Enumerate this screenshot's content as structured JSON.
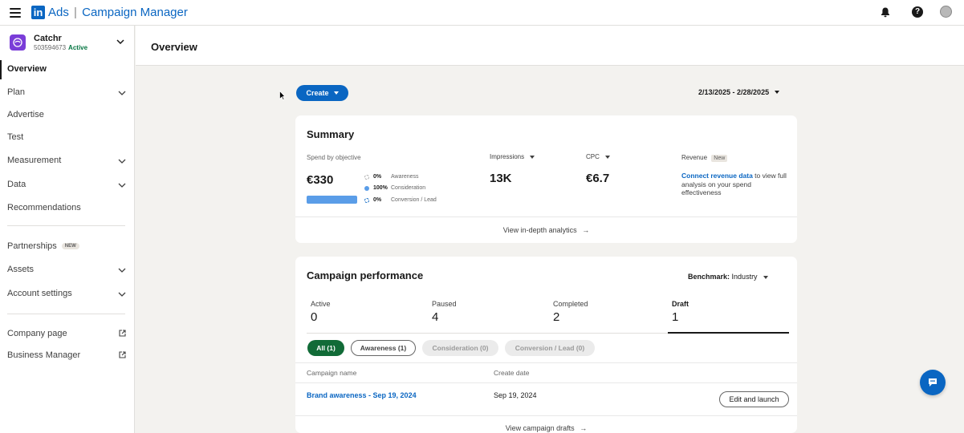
{
  "app": {
    "brand": "Ads",
    "separator": "|",
    "title": "Campaign Manager",
    "logo": "in"
  },
  "account": {
    "name": "Catchr",
    "id": "503594673",
    "status": "Active"
  },
  "sidebar": {
    "items": [
      {
        "label": "Overview"
      },
      {
        "label": "Plan"
      },
      {
        "label": "Advertise"
      },
      {
        "label": "Test"
      },
      {
        "label": "Measurement"
      },
      {
        "label": "Data"
      },
      {
        "label": "Recommendations"
      },
      {
        "label": "Partnerships",
        "badge": "NEW"
      },
      {
        "label": "Assets"
      },
      {
        "label": "Account settings"
      },
      {
        "label": "Company page"
      },
      {
        "label": "Business Manager"
      }
    ]
  },
  "page": {
    "title": "Overview"
  },
  "toolbar": {
    "create_label": "Create",
    "date_range": "2/13/2025 - 2/28/2025"
  },
  "summary": {
    "title": "Summary",
    "spend_label": "Spend by objective",
    "spend_value": "€330",
    "objectives": [
      {
        "pct": "0%",
        "name": "Awareness"
      },
      {
        "pct": "100%",
        "name": "Consideration"
      },
      {
        "pct": "0%",
        "name": "Conversion / Lead"
      }
    ],
    "impressions_label": "Impressions",
    "impressions_value": "13K",
    "cpc_label": "CPC",
    "cpc_value": "€6.7",
    "revenue_label": "Revenue",
    "revenue_badge": "New",
    "revenue_link": "Connect revenue data",
    "revenue_text": " to view full analysis on your spend effectiveness",
    "footer_link": "View in-depth analytics"
  },
  "performance": {
    "title": "Campaign performance",
    "benchmark_label": "Benchmark:",
    "benchmark_value": "Industry",
    "tabs": [
      {
        "label": "Active",
        "count": "0"
      },
      {
        "label": "Paused",
        "count": "4"
      },
      {
        "label": "Completed",
        "count": "2"
      },
      {
        "label": "Draft",
        "count": "1"
      }
    ],
    "filters": [
      {
        "label": "All (1)"
      },
      {
        "label": "Awareness (1)"
      },
      {
        "label": "Consideration (0)"
      },
      {
        "label": "Conversion / Lead (0)"
      }
    ],
    "columns": {
      "name": "Campaign name",
      "date": "Create date"
    },
    "rows": [
      {
        "name": "Brand awareness - Sep 19, 2024",
        "date": "Sep 19, 2024",
        "action": "Edit and launch"
      }
    ],
    "footer_link": "View campaign drafts"
  },
  "colors": {
    "accent": "#0a66c2",
    "active_green": "#116b37",
    "bar_blue": "#5a9de8"
  }
}
